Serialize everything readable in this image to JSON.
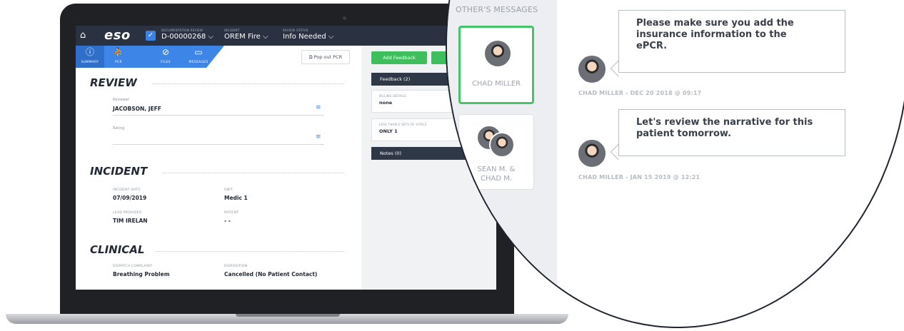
{
  "topbar": {
    "logo": "eso",
    "doc_review_label": "DOCUMENTATION REVIEW",
    "doc_review_value": "D-00000268 ⌵",
    "incident_label": "INCIDENT",
    "incident_value": "OREM Fire ⌵",
    "status_label": "REVIEW STATUS",
    "status_value": "Info Needed ⌵"
  },
  "tabs": [
    {
      "label": "SUMMARY",
      "icon": "info-icon",
      "glyph": "ⓘ"
    },
    {
      "label": "PCR",
      "icon": "person-icon",
      "glyph": "⛹"
    },
    {
      "label": "FILES",
      "icon": "paperclip-icon",
      "glyph": "⊘"
    },
    {
      "label": "MESSAGES",
      "icon": "chat-icon",
      "glyph": "▭"
    }
  ],
  "popout_label": "Pop out PCR",
  "review": {
    "title": "REVIEW",
    "reviewer_label": "Reviewer",
    "reviewer_value": "JACOBSON, JEFF",
    "rating_label": "Rating"
  },
  "incident": {
    "title": "INCIDENT",
    "date_label": "INCIDENT DATE",
    "date_value": "07/09/2019",
    "unit_label": "UNIT",
    "unit_value": "Medic 1",
    "lead_label": "LEAD PROVIDER",
    "lead_value": "TIM IRELAN",
    "patient_label": "PATIENT",
    "patient_value": "- -"
  },
  "clinical": {
    "title": "CLINICAL",
    "complaint_label": "DISPATCH COMPLAINT",
    "complaint_value": "Breathing Problem",
    "disposition_label": "DISPOSITION",
    "disposition_value": "Cancelled (No Patient Contact)"
  },
  "panel": {
    "add_feedback": "Add Feedback",
    "feedback_header": "Feedback (2)",
    "billing_label": "BILLING DETAILS",
    "billing_value": "none",
    "vitals_label": "LESS THAN 2 SETS OF VITALS",
    "vitals_value": "ONLY 1",
    "notes_header": "Notes (0)"
  },
  "zoom": {
    "others_title": "OTHER'S MESSAGES",
    "cards": [
      {
        "name": "CHAD MILLER"
      },
      {
        "name_line1": "SEAN M. &",
        "name_line2": "CHAD M."
      }
    ],
    "messages": [
      {
        "line1": "Please make sure you add the",
        "line2": "insurance information to the",
        "line3": "ePCR.",
        "meta": "CHAD MILLER - DEC 20 2018 @ 09:17"
      },
      {
        "line1": "Let's review the narrative for this",
        "line2": "patient tomorrow.",
        "meta": "CHAD MILLER - JAN 15 2019 @ 12:21"
      }
    ]
  },
  "colors": {
    "topbar": "#2a3140",
    "tab_blue": "#3d85e6",
    "green": "#3fbe5d",
    "active_card_border": "#46c46b"
  }
}
